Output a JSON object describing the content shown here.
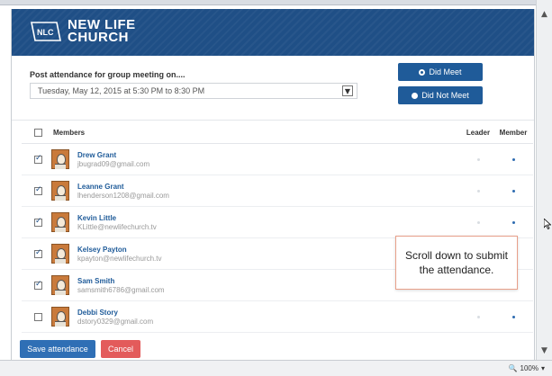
{
  "header": {
    "logo_mark": "NLC",
    "logo_line1": "NEW LIFE",
    "logo_line2": "CHURCH"
  },
  "post": {
    "label": "Post attendance for group meeting on....",
    "date_value": "Tuesday, May 12, 2015 at 5:30 PM to 8:30 PM",
    "did_meet_label": "Did Meet",
    "did_not_meet_label": "Did Not Meet"
  },
  "members_table": {
    "header": {
      "members": "Members",
      "leader": "Leader",
      "member": "Member"
    },
    "rows": [
      {
        "name": "Drew Grant",
        "email": "jbugrad09@gmail.com",
        "checked": true,
        "leader": false,
        "member": true
      },
      {
        "name": "Leanne Grant",
        "email": "lhenderson1208@gmail.com",
        "checked": true,
        "leader": false,
        "member": true
      },
      {
        "name": "Kevin Little",
        "email": "KLittle@newlifechurch.tv",
        "checked": true,
        "leader": false,
        "member": true
      },
      {
        "name": "Kelsey Payton",
        "email": "kpayton@newlifechurch.tv",
        "checked": true,
        "leader": false,
        "member": true
      },
      {
        "name": "Sam Smith",
        "email": "samsmith6786@gmail.com",
        "checked": true,
        "leader": false,
        "member": true
      },
      {
        "name": "Debbi Story",
        "email": "dstory0329@gmail.com",
        "checked": false,
        "leader": false,
        "member": true
      }
    ]
  },
  "actions": {
    "save_label": "Save attendance",
    "cancel_label": "Cancel"
  },
  "tooltip": {
    "text": "Scroll down to submit the attendance."
  },
  "status_bar": {
    "zoom": "100%"
  },
  "colors": {
    "header_bg": "#1f4f86",
    "primary": "#2f6fb5",
    "danger": "#e35b5b",
    "link": "#1f5b99"
  }
}
